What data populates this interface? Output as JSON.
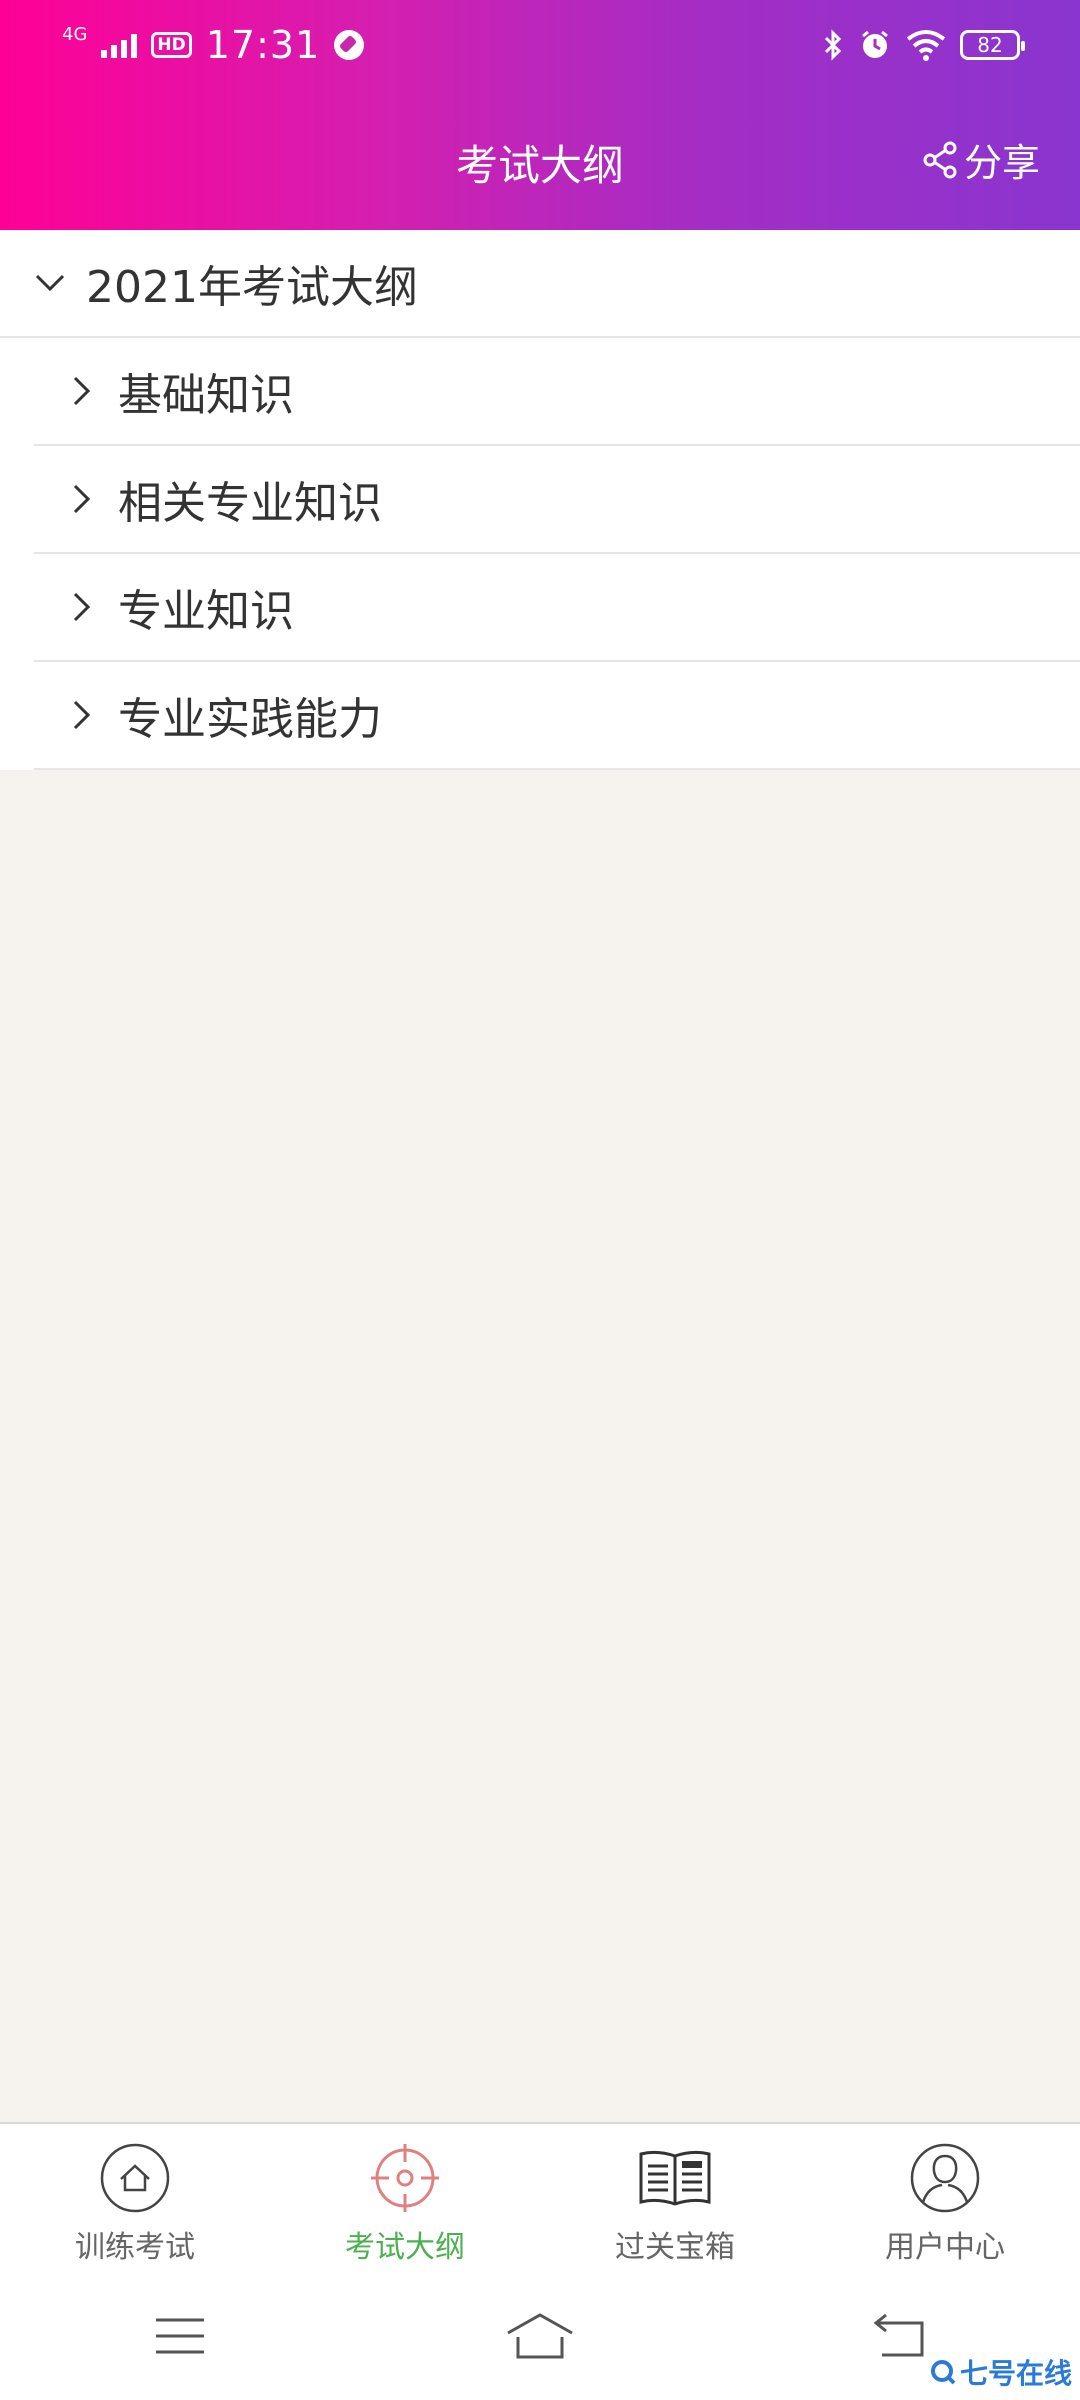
{
  "status_bar": {
    "network": "4G",
    "hd": "HD",
    "time": "17:31",
    "battery": "82"
  },
  "header": {
    "title": "考试大纲",
    "share_label": "分享"
  },
  "outline": {
    "parent_label": "2021年考试大纲",
    "items": [
      {
        "label": "基础知识"
      },
      {
        "label": "相关专业知识"
      },
      {
        "label": "专业知识"
      },
      {
        "label": "专业实践能力"
      }
    ]
  },
  "bottom_nav": {
    "items": [
      {
        "label": "训练考试",
        "icon": "home-icon"
      },
      {
        "label": "考试大纲",
        "icon": "target-icon",
        "active": true
      },
      {
        "label": "过关宝箱",
        "icon": "book-icon"
      },
      {
        "label": "用户中心",
        "icon": "user-icon"
      }
    ]
  },
  "watermark": "七号在线",
  "colors": {
    "header_start": "#ff0096",
    "header_end": "#8a35cf",
    "active_nav": "#4caf50",
    "target_icon": "#e08080"
  }
}
